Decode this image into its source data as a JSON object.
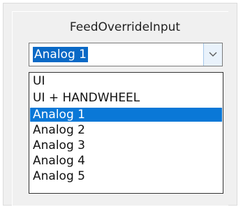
{
  "field": {
    "label": "FeedOverrideInput"
  },
  "combo": {
    "value": "Analog 1",
    "button_icon": "chevron-down-icon"
  },
  "dropdown": {
    "items": [
      {
        "label": "UI",
        "selected": false
      },
      {
        "label": "UI + HANDWHEEL",
        "selected": false
      },
      {
        "label": "Analog 1",
        "selected": true
      },
      {
        "label": "Analog 2",
        "selected": false
      },
      {
        "label": "Analog 3",
        "selected": false
      },
      {
        "label": "Analog 4",
        "selected": false
      },
      {
        "label": "Analog 5",
        "selected": false
      }
    ]
  },
  "colors": {
    "selection": "#0a78d7",
    "panel_bg": "#f0f0f0",
    "combo_button_bg": "#e9f2fb"
  }
}
